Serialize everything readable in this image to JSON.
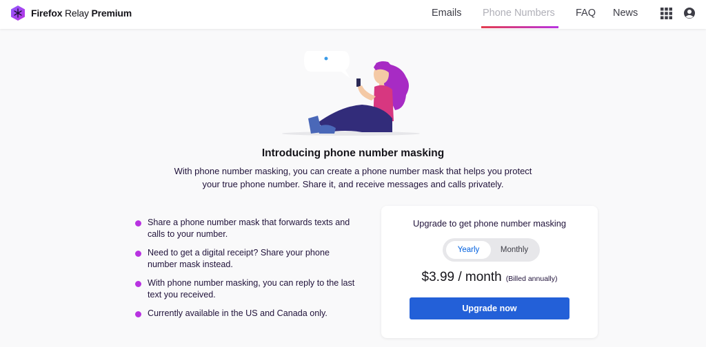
{
  "header": {
    "brand": {
      "bold": "Firefox",
      "regular": "Relay",
      "tier": "Premium"
    },
    "nav": [
      {
        "label": "Emails",
        "active": false
      },
      {
        "label": "Phone Numbers",
        "active": true
      },
      {
        "label": "FAQ",
        "active": false
      },
      {
        "label": "News",
        "active": false
      }
    ],
    "icons": [
      "apps-grid-icon",
      "account-icon"
    ]
  },
  "hero": {
    "illustration": "woman-with-phone-illustration",
    "title": "Introducing phone number masking",
    "subtitle": "With phone number masking, you can create a phone number mask that helps you protect your true phone number. Share it, and receive messages and calls privately."
  },
  "features": [
    "Share a phone number mask that forwards texts and calls to your number.",
    "Need to get a digital receipt? Share your phone number mask instead.",
    "With phone number masking, you can reply to the last text you received.",
    "Currently available in the US and Canada only."
  ],
  "upgrade_card": {
    "title": "Upgrade to get phone number masking",
    "billing_options": [
      {
        "label": "Yearly",
        "selected": true
      },
      {
        "label": "Monthly",
        "selected": false
      }
    ],
    "price": "$3.99 / month",
    "billing_note": "(Billed annually)",
    "button_label": "Upgrade now"
  },
  "colors": {
    "accent_gradient_start": "#e33c4e",
    "accent_gradient_end": "#b833e1",
    "bullet": "#b833e1",
    "primary_button": "#2360d8",
    "selected_toggle_text": "#0060df"
  }
}
